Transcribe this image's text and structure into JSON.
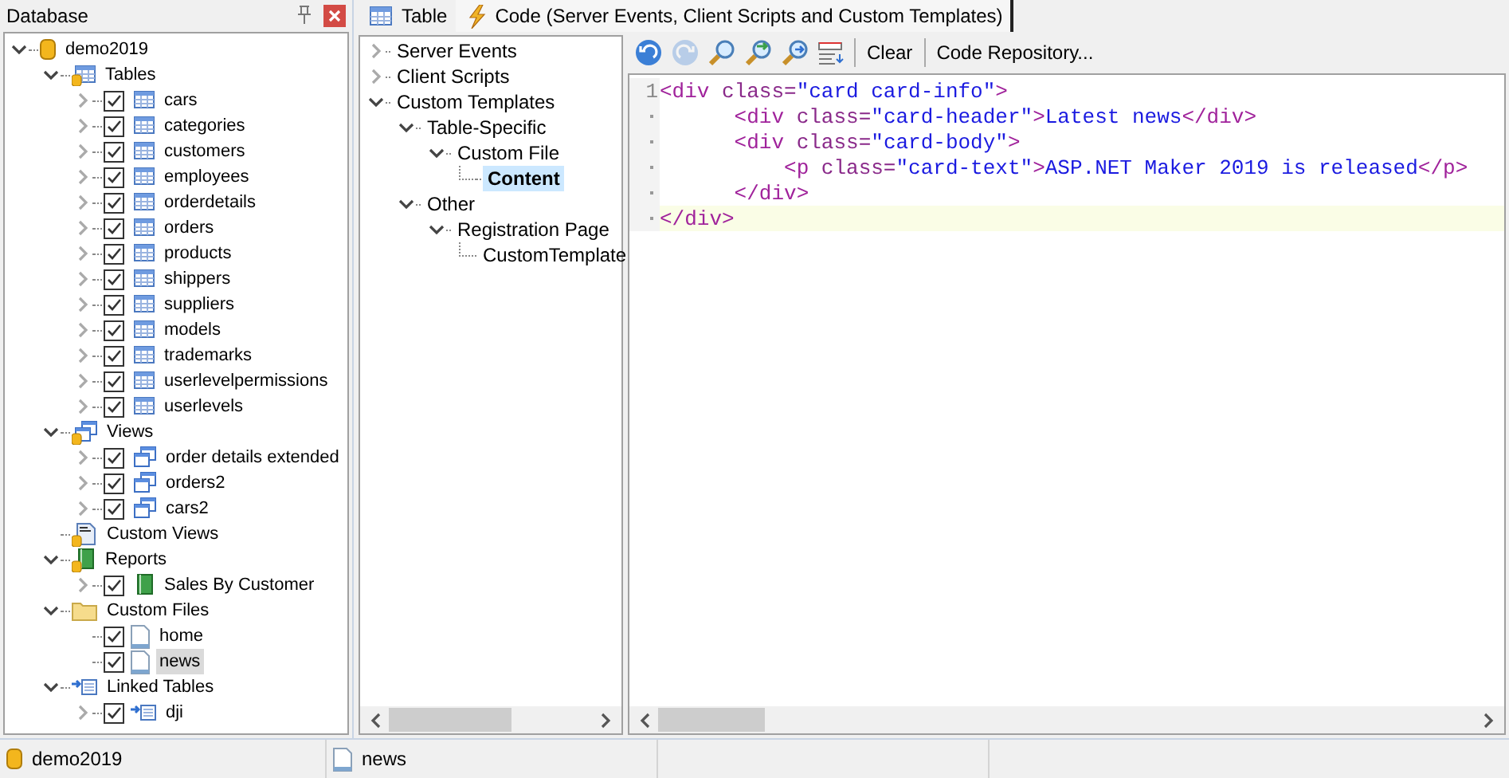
{
  "database_panel": {
    "title": "Database",
    "tree": [
      {
        "label": "demo2019",
        "kind": "db",
        "expanded": true,
        "selected": false,
        "children": [
          {
            "label": "Tables",
            "kind": "tables",
            "expanded": true,
            "selected": false,
            "children": [
              {
                "label": "cars",
                "kind": "table",
                "expanded": false,
                "checked": true,
                "selected": false
              },
              {
                "label": "categories",
                "kind": "table",
                "expanded": false,
                "checked": true,
                "selected": false
              },
              {
                "label": "customers",
                "kind": "table",
                "expanded": false,
                "checked": true,
                "selected": false
              },
              {
                "label": "employees",
                "kind": "table",
                "expanded": false,
                "checked": true,
                "selected": false
              },
              {
                "label": "orderdetails",
                "kind": "table",
                "expanded": false,
                "checked": true,
                "selected": false
              },
              {
                "label": "orders",
                "kind": "table",
                "expanded": false,
                "checked": true,
                "selected": false
              },
              {
                "label": "products",
                "kind": "table",
                "expanded": false,
                "checked": true,
                "selected": false
              },
              {
                "label": "shippers",
                "kind": "table",
                "expanded": false,
                "checked": true,
                "selected": false
              },
              {
                "label": "suppliers",
                "kind": "table",
                "expanded": false,
                "checked": true,
                "selected": false
              },
              {
                "label": "models",
                "kind": "table",
                "expanded": false,
                "checked": true,
                "selected": false
              },
              {
                "label": "trademarks",
                "kind": "table",
                "expanded": false,
                "checked": true,
                "selected": false
              },
              {
                "label": "userlevelpermissions",
                "kind": "table",
                "expanded": false,
                "checked": true,
                "selected": false
              },
              {
                "label": "userlevels",
                "kind": "table",
                "expanded": false,
                "checked": true,
                "selected": false
              }
            ]
          },
          {
            "label": "Views",
            "kind": "views",
            "expanded": true,
            "selected": false,
            "children": [
              {
                "label": "order details extended",
                "kind": "view",
                "expanded": false,
                "checked": true,
                "selected": false
              },
              {
                "label": "orders2",
                "kind": "view",
                "expanded": false,
                "checked": true,
                "selected": false
              },
              {
                "label": "cars2",
                "kind": "view",
                "expanded": false,
                "checked": true,
                "selected": false
              }
            ]
          },
          {
            "label": "Custom Views",
            "kind": "sql",
            "selected": false
          },
          {
            "label": "Reports",
            "kind": "reports",
            "expanded": true,
            "selected": false,
            "children": [
              {
                "label": "Sales By Customer",
                "kind": "report",
                "expanded": false,
                "checked": true,
                "selected": false
              }
            ]
          },
          {
            "label": "Custom Files",
            "kind": "folder",
            "expanded": true,
            "selected": false,
            "children": [
              {
                "label": "home",
                "kind": "file",
                "checked": true,
                "selected": false
              },
              {
                "label": "news",
                "kind": "file",
                "checked": true,
                "selected": true
              }
            ]
          },
          {
            "label": "Linked Tables",
            "kind": "linked",
            "expanded": true,
            "selected": false,
            "children": [
              {
                "label": "dji",
                "kind": "linkedtable",
                "expanded": false,
                "checked": true,
                "selected": false
              }
            ]
          }
        ]
      }
    ]
  },
  "tabs": [
    {
      "label": "Table",
      "kind": "table",
      "selected": false
    },
    {
      "label": "Code (Server Events, Client Scripts and Custom Templates)",
      "kind": "code",
      "selected": true
    }
  ],
  "code_tree": [
    {
      "label": "Server Events",
      "expanded": false,
      "selected": false
    },
    {
      "label": "Client Scripts",
      "expanded": false,
      "selected": false
    },
    {
      "label": "Custom Templates",
      "expanded": true,
      "selected": false,
      "children": [
        {
          "label": "Table-Specific",
          "expanded": true,
          "selected": false,
          "children": [
            {
              "label": "Custom File",
              "expanded": true,
              "selected": false,
              "children": [
                {
                  "label": "Content",
                  "selected": true
                }
              ]
            }
          ]
        },
        {
          "label": "Other",
          "expanded": true,
          "selected": false,
          "children": [
            {
              "label": "Registration Page",
              "expanded": true,
              "selected": false,
              "children": [
                {
                  "label": "CustomTemplate",
                  "selected": false
                }
              ]
            }
          ]
        }
      ]
    }
  ],
  "toolbar": {
    "icons": [
      {
        "kind": "undo",
        "disabled": false
      },
      {
        "kind": "redo",
        "disabled": true
      },
      {
        "kind": "find",
        "disabled": false
      },
      {
        "kind": "replace",
        "disabled": false
      },
      {
        "kind": "find_next",
        "disabled": false
      },
      {
        "kind": "format",
        "disabled": false
      }
    ],
    "buttons": [
      "Clear",
      "Code Repository..."
    ]
  },
  "editor": {
    "lines": [
      {
        "number": "1",
        "current": false,
        "tokens": [
          {
            "kind": "tag",
            "text": "<div "
          },
          {
            "kind": "attr",
            "text": "class="
          },
          {
            "kind": "value",
            "text": "\"card card-info\""
          },
          {
            "kind": "tag",
            "text": ">"
          }
        ]
      },
      {
        "current": false,
        "tokens": [
          {
            "kind": "tag",
            "text": "      <div "
          },
          {
            "kind": "attr",
            "text": "class="
          },
          {
            "kind": "value",
            "text": "\"card-header\""
          },
          {
            "kind": "tag",
            "text": ">"
          },
          {
            "kind": "text",
            "text": "Latest news"
          },
          {
            "kind": "tag",
            "text": "</div>"
          }
        ]
      },
      {
        "current": false,
        "tokens": [
          {
            "kind": "tag",
            "text": "      <div "
          },
          {
            "kind": "attr",
            "text": "class="
          },
          {
            "kind": "value",
            "text": "\"card-body\""
          },
          {
            "kind": "tag",
            "text": ">"
          }
        ]
      },
      {
        "current": false,
        "tokens": [
          {
            "kind": "tag",
            "text": "          <p "
          },
          {
            "kind": "attr",
            "text": "class="
          },
          {
            "kind": "value",
            "text": "\"card-text\""
          },
          {
            "kind": "tag",
            "text": ">"
          },
          {
            "kind": "text",
            "text": "ASP.NET Maker 2019 is released"
          },
          {
            "kind": "tag",
            "text": "</p>"
          }
        ]
      },
      {
        "current": false,
        "tokens": [
          {
            "kind": "tag",
            "text": "      </div>"
          }
        ]
      },
      {
        "current": true,
        "tokens": [
          {
            "kind": "tag",
            "text": "</div>"
          }
        ]
      }
    ]
  },
  "status_bar": [
    {
      "text": "demo2019",
      "kind": "db"
    },
    {
      "text": "news",
      "kind": "file"
    }
  ]
}
